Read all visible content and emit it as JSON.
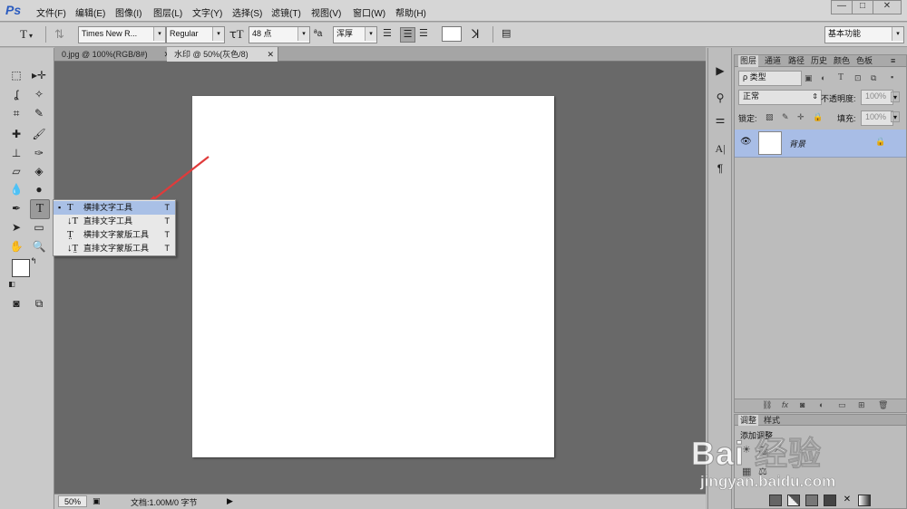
{
  "app": {
    "logo": "Ps"
  },
  "menu": [
    "文件(F)",
    "编辑(E)",
    "图像(I)",
    "图层(L)",
    "文字(Y)",
    "选择(S)",
    "滤镜(T)",
    "视图(V)",
    "窗口(W)",
    "帮助(H)"
  ],
  "window_controls": {
    "minimize": "—",
    "restore": "□",
    "close": "✕"
  },
  "options": {
    "font_family": "Times New R...",
    "font_style": "Regular",
    "font_size": "48 点",
    "aa_label": "ªa",
    "antialias": "浑厚",
    "workspace": "基本功能"
  },
  "tabs": [
    {
      "label": "0.jpg @ 100%(RGB/8#)",
      "close": "✕"
    },
    {
      "label": "水印 @ 50%(灰色/8)",
      "close": "✕"
    }
  ],
  "status": {
    "zoom": "50%",
    "doc_info": "文档:1.00M/0 字节"
  },
  "flyout": {
    "items": [
      {
        "icon": "T",
        "label": "横排文字工具",
        "shortcut": "T",
        "active_marker": "▪"
      },
      {
        "icon": "↓T",
        "label": "直排文字工具",
        "shortcut": "T"
      },
      {
        "icon": "T̤",
        "label": "横排文字蒙版工具",
        "shortcut": "T"
      },
      {
        "icon": "↓T̤",
        "label": "直排文字蒙版工具",
        "shortcut": "T"
      }
    ]
  },
  "layers_panel": {
    "tabs": [
      "图层",
      "通道",
      "路径",
      "历史",
      "颜色",
      "色板"
    ],
    "filter_label": "ρ 类型",
    "blend_mode": "正常",
    "opacity_label": "不透明度:",
    "opacity_value": "100%",
    "lock_label": "锁定:",
    "fill_label": "填充:",
    "fill_value": "100%",
    "layer_name": "背景"
  },
  "adjustments_panel": {
    "tabs": [
      "调整",
      "样式"
    ],
    "add_label": "添加调整"
  },
  "watermark": {
    "text": "Bai 经验",
    "url": "jingyan.baidu.com"
  },
  "colors": {
    "accent": "#a8bde6",
    "arrow": "#e03b3b",
    "canvas_bg": "#696969"
  }
}
